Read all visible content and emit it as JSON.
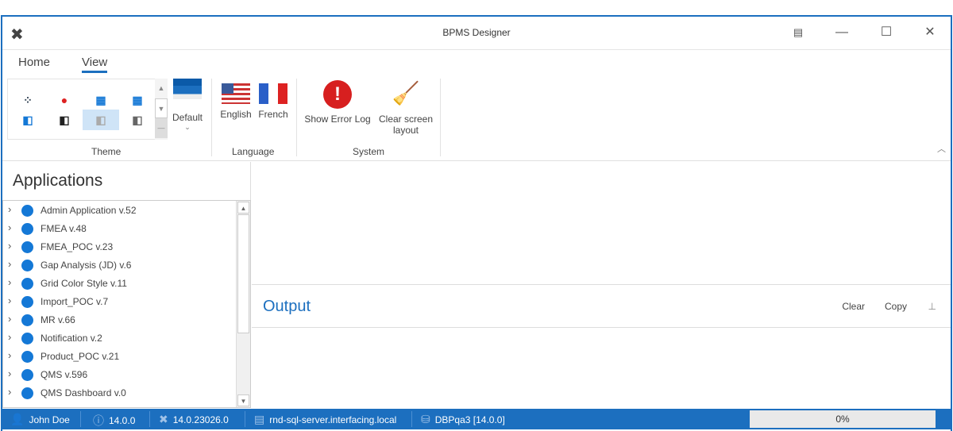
{
  "window": {
    "title": "BPMS Designer"
  },
  "tabs": [
    {
      "label": "Home"
    },
    {
      "label": "View"
    }
  ],
  "ribbon": {
    "theme_group": "Theme",
    "theme_default": "Default",
    "language_group": "Language",
    "english": "English",
    "french": "French",
    "system_group": "System",
    "show_error_log": "Show Error Log",
    "clear_layout_line1": "Clear screen",
    "clear_layout_line2": "layout"
  },
  "applications": {
    "title": "Applications",
    "items": [
      "Admin Application v.52",
      "FMEA v.48",
      "FMEA_POC v.23",
      "Gap Analysis (JD) v.6",
      "Grid Color Style v.11",
      "Import_POC v.7",
      "MR v.66",
      "Notification v.2",
      "Product_POC v.21",
      "QMS v.596",
      "QMS Dashboard v.0"
    ]
  },
  "output": {
    "title": "Output",
    "clear": "Clear",
    "copy": "Copy"
  },
  "status": {
    "user": "John Doe",
    "version": "14.0.0",
    "build": "14.0.23026.0",
    "server": "rnd-sql-server.interfacing.local",
    "database": "DBPqa3 [14.0.0]",
    "progress": "0%"
  },
  "colors": {
    "accent": "#1c6fbf"
  }
}
